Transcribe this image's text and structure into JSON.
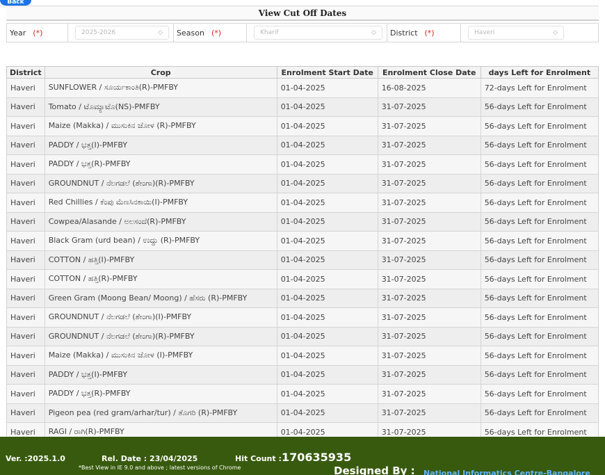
{
  "back_label": "Back",
  "page_title": "View Cut Off Dates",
  "filters": {
    "year": {
      "label": "Year",
      "required": "(*)",
      "value": "2025-2026"
    },
    "season": {
      "label": "Season",
      "required": "(*)",
      "value": "Kharif"
    },
    "district": {
      "label": "District",
      "required": "(*)",
      "value": "Haveri"
    }
  },
  "table": {
    "headers": [
      "District",
      "Crop",
      "Enrolment Start Date",
      "Enrolment Close Date",
      "days Left for Enrolment"
    ],
    "rows": [
      [
        "Haveri",
        "SUNFLOWER / ಸೂರ್ಯಕಾಂತಿ(R)-PMFBY",
        "01-04-2025",
        "16-08-2025",
        "72-days Left for Enrolment"
      ],
      [
        "Haveri",
        "Tomato / ಟೊಮ್ಯಾಟೊ(NS)-PMFBY",
        "01-04-2025",
        "31-07-2025",
        "56-days Left for Enrolment"
      ],
      [
        "Haveri",
        "Maize (Makka) / ಮುಸುಕಿನ ಜೋಳ (R)-PMFBY",
        "01-04-2025",
        "31-07-2025",
        "56-days Left for Enrolment"
      ],
      [
        "Haveri",
        "PADDY / ಭತ್ತ(I)-PMFBY",
        "01-04-2025",
        "31-07-2025",
        "56-days Left for Enrolment"
      ],
      [
        "Haveri",
        "PADDY / ಭತ್ತ(R)-PMFBY",
        "01-04-2025",
        "31-07-2025",
        "56-days Left for Enrolment"
      ],
      [
        "Haveri",
        "GROUNDNUT / ನೆಲಗಡಲೆ (ಶೇಂಗಾ)(R)-PMFBY",
        "01-04-2025",
        "31-07-2025",
        "56-days Left for Enrolment"
      ],
      [
        "Haveri",
        "Red Chillies / ಕೆಂಪು ಮೆಣಸಿನಕಾಯಿ(I)-PMFBY",
        "01-04-2025",
        "31-07-2025",
        "56-days Left for Enrolment"
      ],
      [
        "Haveri",
        "Cowpea/Alasande / ಅಲಸಂದೆ(R)-PMFBY",
        "01-04-2025",
        "31-07-2025",
        "56-days Left for Enrolment"
      ],
      [
        "Haveri",
        "Black Gram (urd bean) / ಉದ್ದು (R)-PMFBY",
        "01-04-2025",
        "31-07-2025",
        "56-days Left for Enrolment"
      ],
      [
        "Haveri",
        "COTTON / ಹತ್ತಿ(I)-PMFBY",
        "01-04-2025",
        "31-07-2025",
        "56-days Left for Enrolment"
      ],
      [
        "Haveri",
        "COTTON / ಹತ್ತಿ(R)-PMFBY",
        "01-04-2025",
        "31-07-2025",
        "56-days Left for Enrolment"
      ],
      [
        "Haveri",
        "Green Gram (Moong Bean/ Moong) / ಹೆಸರು (R)-PMFBY",
        "01-04-2025",
        "31-07-2025",
        "56-days Left for Enrolment"
      ],
      [
        "Haveri",
        "GROUNDNUT / ನೆಲಗಡಲೆ (ಶೇಂಗಾ)(I)-PMFBY",
        "01-04-2025",
        "31-07-2025",
        "56-days Left for Enrolment"
      ],
      [
        "Haveri",
        "GROUNDNUT / ನೆಲಗಡಲೆ (ಶೇಂಗಾ)(R)-PMFBY",
        "01-04-2025",
        "31-07-2025",
        "56-days Left for Enrolment"
      ],
      [
        "Haveri",
        "Maize (Makka) / ಮುಸುಕಿನ ಜೋಳ (I)-PMFBY",
        "01-04-2025",
        "31-07-2025",
        "56-days Left for Enrolment"
      ],
      [
        "Haveri",
        "PADDY / ಭತ್ತ(I)-PMFBY",
        "01-04-2025",
        "31-07-2025",
        "56-days Left for Enrolment"
      ],
      [
        "Haveri",
        "PADDY / ಭತ್ತ(R)-PMFBY",
        "01-04-2025",
        "31-07-2025",
        "56-days Left for Enrolment"
      ],
      [
        "Haveri",
        "Pigeon pea (red gram/arhar/tur) / ತೊಗರಿ (R)-PMFBY",
        "01-04-2025",
        "31-07-2025",
        "56-days Left for Enrolment"
      ],
      [
        "Haveri",
        "RAGI / ರಾಗಿ(R)-PMFBY",
        "01-04-2025",
        "31-07-2025",
        "56-days Left for Enrolment"
      ]
    ]
  },
  "footer": {
    "version": "Ver. :2025.1.0",
    "release": "Rel. Date : 23/04/2025",
    "best_view": "*Best View in IE 9.0 and above ; latest versions of Chrome",
    "hit_label": "Hit Count :",
    "hit_count": "170635935",
    "designed_label": "Designed By :",
    "designed_by": "National Informatics Centre-Bangalore"
  }
}
